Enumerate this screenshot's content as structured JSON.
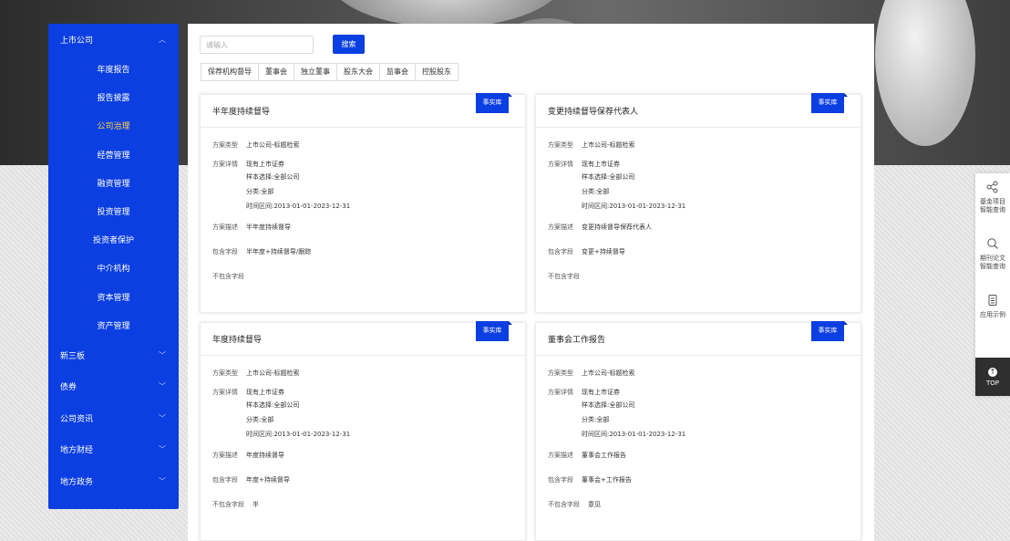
{
  "sidebar": {
    "top": {
      "label": "上市公司",
      "icon": "chevron-up-icon"
    },
    "sub_items": [
      {
        "label": "年度报告"
      },
      {
        "label": "报告披露"
      },
      {
        "label": "公司治理",
        "active": true
      },
      {
        "label": "经营管理"
      },
      {
        "label": "融资管理"
      },
      {
        "label": "投资管理"
      },
      {
        "label": "投资者保护"
      },
      {
        "label": "中介机构"
      },
      {
        "label": "资本管理"
      },
      {
        "label": "资产管理"
      }
    ],
    "groups": [
      {
        "label": "新三板"
      },
      {
        "label": "债券"
      },
      {
        "label": "公司资讯"
      },
      {
        "label": "地方财经"
      },
      {
        "label": "地方政务"
      }
    ],
    "accent": "#0c3fe1",
    "active_color": "#ffd24a"
  },
  "search": {
    "placeholder": "请输入",
    "button": "搜索"
  },
  "tabs": [
    "保荐机构督导",
    "董事会",
    "独立董事",
    "股东大会",
    "监事会",
    "控股股东"
  ],
  "labels": {
    "type": "方案类型",
    "detail": "方案详情",
    "desc": "方案描述",
    "include": "包含字段",
    "exclude": "不包含字段"
  },
  "cards": [
    {
      "title": "半年度持续督导",
      "badge": "事实库",
      "type": "上市公司-标题检索",
      "detail": "现有上市证券",
      "sample": "样本选择:全部公司",
      "category": "分类:全部",
      "range": "时间区间:2013-01-01-2023-12-31",
      "desc": "半年度持续督导",
      "include": "半年度+持续督导/跟踪",
      "exclude": ""
    },
    {
      "title": "变更持续督导保荐代表人",
      "badge": "事实库",
      "type": "上市公司-标题检索",
      "detail": "现有上市证券",
      "sample": "样本选择:全部公司",
      "category": "分类:全部",
      "range": "时间区间:2013-01-01-2023-12-31",
      "desc": "变更持续督导保荐代表人",
      "include": "变更+持续督导",
      "exclude": ""
    },
    {
      "title": "年度持续督导",
      "badge": "事实库",
      "type": "上市公司-标题检索",
      "detail": "现有上市证券",
      "sample": "样本选择:全部公司",
      "category": "分类:全部",
      "range": "时间区间:2013-01-01-2023-12-31",
      "desc": "年度持续督导",
      "include": "年度+持续督导",
      "exclude": "半"
    },
    {
      "title": "董事会工作报告",
      "badge": "事实库",
      "type": "上市公司-标题检索",
      "detail": "现有上市证券",
      "sample": "样本选择:全部公司",
      "category": "分类:全部",
      "range": "时间区间:2013-01-01-2023-12-31",
      "desc": "董事会工作报告",
      "include": "董事会+工作报告",
      "exclude": "意见"
    }
  ],
  "float": {
    "items": [
      {
        "icon": "share-nodes-icon",
        "line1": "基金项目",
        "line2": "智能查询"
      },
      {
        "icon": "search-icon",
        "line1": "期刊论文",
        "line2": "智能查询"
      },
      {
        "icon": "document-icon",
        "line1": "应用示例",
        "line2": ""
      }
    ],
    "top": "TOP"
  }
}
